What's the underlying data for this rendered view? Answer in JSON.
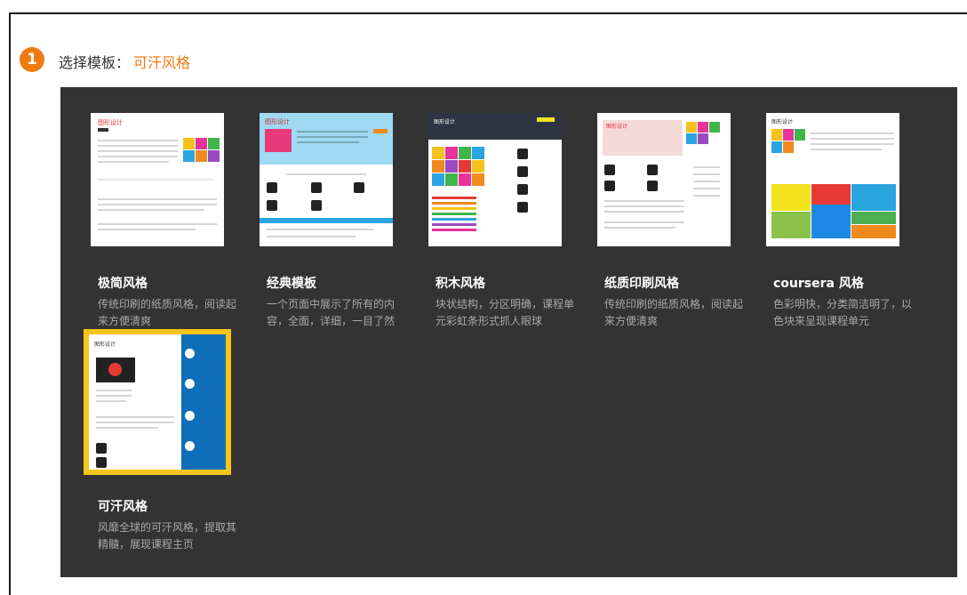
{
  "step": {
    "number": "1",
    "label": "选择模板：",
    "selected": "可汗风格"
  },
  "colors": {
    "accent": "#f07a12",
    "panel_bg": "#333333",
    "selected_outline": "#f5c518",
    "desc_text": "#a9a9a9"
  },
  "templates": [
    {
      "title": "极简风格",
      "desc": "传统印刷的纸质风格，阅读起来方便清爽",
      "selected": false
    },
    {
      "title": "经典模板",
      "desc": "一个页面中展示了所有的内容，全面，详细，一目了然",
      "selected": false
    },
    {
      "title": "积木风格",
      "desc": "块状结构，分区明确，课程单元彩虹条形式抓人眼球",
      "selected": false
    },
    {
      "title": "纸质印刷风格",
      "desc": "传统印刷的纸质风格，阅读起来方便清爽",
      "selected": false
    },
    {
      "title": "coursera 风格",
      "desc": "色彩明快，分类简洁明了，以色块来呈现课程单元",
      "selected": false
    },
    {
      "title": "可汗风格",
      "desc": "风靡全球的可汗风格，提取其精髓，展现课程主页",
      "selected": true
    }
  ]
}
